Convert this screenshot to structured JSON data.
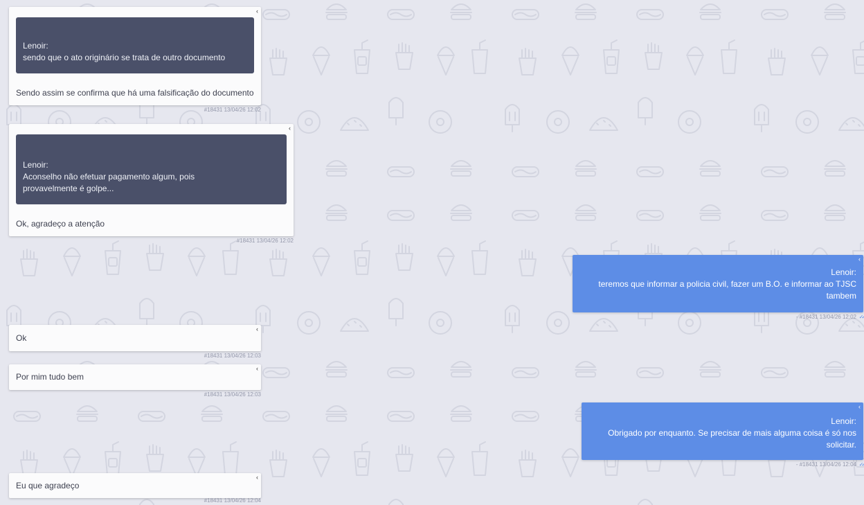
{
  "colors": {
    "background": "#e6e7ef",
    "incoming_bubble": "#fbfbfc",
    "quoted_block": "#4a5069",
    "outgoing_bubble": "#5d8de6"
  },
  "messages": [
    {
      "direction": "incoming",
      "menu_icon": "chevron-left-icon",
      "quote": {
        "author": "Lenoir:",
        "text": "sendo que o ato originário se trata de outro documento"
      },
      "text": "Sendo assim se confirma que há uma falsificação do documento",
      "meta": "#18431 13/04/26 12:02"
    },
    {
      "direction": "incoming",
      "menu_icon": "chevron-left-icon",
      "quote": {
        "author": "Lenoir:",
        "text": "Aconselho não efetuar pagamento algum, pois provavelmente é golpe..."
      },
      "text": "Ok, agradeço a atenção",
      "meta": "#18431 13/04/26 12:02"
    },
    {
      "direction": "outgoing",
      "menu_icon": "chevron-left-icon",
      "sender": "Lenoir:",
      "text": "teremos que informar a policia civil, fazer um B.O. e informar ao TJSC tambem",
      "meta": "- #18431 13/04/26 12:02",
      "status_icon": "double-check-icon"
    },
    {
      "direction": "incoming",
      "menu_icon": "chevron-left-icon",
      "text": "Ok",
      "meta": "#18431 13/04/26 12:03"
    },
    {
      "direction": "incoming",
      "menu_icon": "chevron-left-icon",
      "text": "Por mim tudo bem",
      "meta": "#18431 13/04/26 12:03"
    },
    {
      "direction": "outgoing",
      "menu_icon": "chevron-left-icon",
      "sender": "Lenoir:",
      "text": "Obrigado por enquanto. Se precisar de mais alguma coisa é só nos solicitar.",
      "meta": "- #18431 13/04/26 12:04",
      "status_icon": "double-check-icon"
    },
    {
      "direction": "incoming",
      "menu_icon": "chevron-left-icon",
      "text": "Eu que agradeço",
      "meta": "#18431 13/04/26 12:04"
    }
  ]
}
